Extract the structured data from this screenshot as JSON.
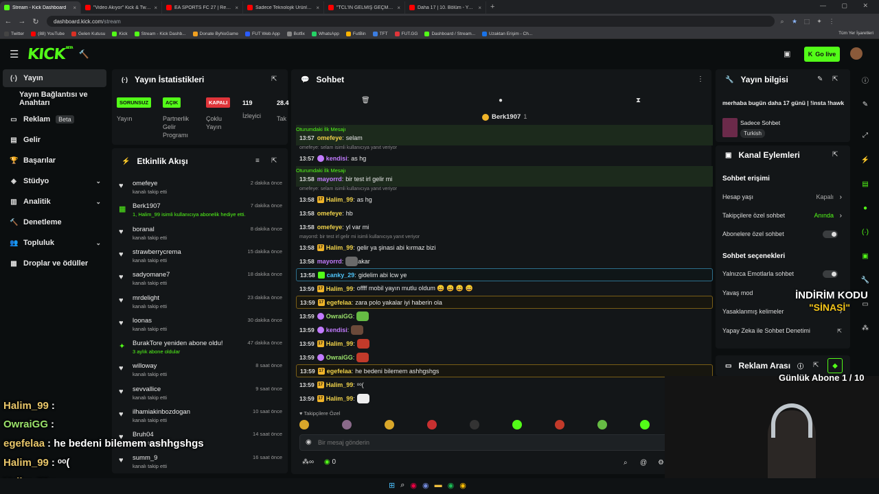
{
  "browser": {
    "tabs": [
      {
        "label": "Stream - Kick Dashboard",
        "color": "#53fc18",
        "active": true
      },
      {
        "label": "\"Video Akıyor\" Kick & Twitch İ",
        "color": "#ff0000"
      },
      {
        "label": "EA SPORTS FC 27 | Resmi Footb",
        "color": "#ff0000"
      },
      {
        "label": "Sadece Teknolojik Ürünleri Topl",
        "color": "#ff0000"
      },
      {
        "label": "\"TCL'İN GELMİŞ GEÇMİŞ EN İYİ",
        "color": "#ff0000"
      },
      {
        "label": "Daha 17 | 10. Bölüm - YouTube",
        "color": "#ff0000"
      }
    ],
    "new_tab": "+",
    "url_host": "dashboard.kick.com",
    "url_path": "/stream",
    "bookmarks": [
      {
        "label": "Twitter",
        "color": "#444"
      },
      {
        "label": "(88) YouTube",
        "color": "#ff0000"
      },
      {
        "label": "Gelen Kutusu",
        "color": "#d93025"
      },
      {
        "label": "Kick",
        "color": "#53fc18"
      },
      {
        "label": "Stream - Kick Dashb...",
        "color": "#53fc18"
      },
      {
        "label": "Donate ByNoGame",
        "color": "#f0a020"
      },
      {
        "label": "FUT Web App",
        "color": "#2a5cff"
      },
      {
        "label": "Botfix",
        "color": "#888"
      },
      {
        "label": "WhatsApp",
        "color": "#25d366"
      },
      {
        "label": "FutBin",
        "color": "#ffb400"
      },
      {
        "label": "TFT",
        "color": "#3c7de0"
      },
      {
        "label": "FUT.GG",
        "color": "#e0353a"
      },
      {
        "label": "Dashboard / Stream...",
        "color": "#53fc18"
      },
      {
        "label": "Uzaktan Erişim - Ch...",
        "color": "#1a73e8"
      }
    ],
    "all_bookmarks": "Tüm Yer İşaretleri"
  },
  "header": {
    "logo": "KICK",
    "logo_sup": "BETA",
    "go_live": "Go live"
  },
  "sidebar": {
    "items": [
      {
        "label": "Yayın",
        "icon": "broadcast-icon"
      },
      {
        "label": "Yayın Bağlantısı ve Anahtarı",
        "icon": ""
      },
      {
        "label": "Reklam",
        "icon": "ad-icon",
        "badge": "Beta"
      },
      {
        "label": "Gelir",
        "icon": "wallet-icon"
      },
      {
        "label": "Başarılar",
        "icon": "trophy-icon"
      },
      {
        "label": "Stüdyo",
        "icon": "layers-icon"
      },
      {
        "label": "Analitik",
        "icon": "chart-icon"
      },
      {
        "label": "Denetleme",
        "icon": "hammer-icon"
      },
      {
        "label": "Topluluk",
        "icon": "people-icon"
      },
      {
        "label": "Droplar ve ödüller",
        "icon": "gift-icon"
      }
    ]
  },
  "stats": {
    "title": "Yayın İstatistikleri",
    "items": [
      {
        "badge": "SORUNSUZ",
        "label": "Yayın",
        "badge_bg": "#53fc18",
        "badge_fg": "#111"
      },
      {
        "badge": "AÇIK",
        "label": "Partnerlik Gelir Programı",
        "badge_bg": "#53fc18",
        "badge_fg": "#111"
      },
      {
        "badge": "KAPALI",
        "label": "Çoklu Yayın",
        "badge_bg": "#e0353a",
        "badge_fg": "#fff"
      },
      {
        "badge": "119",
        "label": "İzleyici",
        "badge_bg": "",
        "badge_fg": "#fff"
      },
      {
        "badge": "28.4",
        "label": "Taki",
        "badge_bg": "",
        "badge_fg": "#fff"
      }
    ]
  },
  "activity": {
    "title": "Etkinlik Akışı",
    "events": [
      {
        "name": "omefeye",
        "sub": "kanalı takip etti",
        "time": "2 dakika önce",
        "icon": "heart-icon"
      },
      {
        "name": "Berk1907",
        "sub": "1, Halim_99 isimli kullanıcıya abonelik hediye etti.",
        "time": "7 dakika önce",
        "icon": "gift-icon",
        "green": true
      },
      {
        "name": "boranal",
        "sub": "kanalı takip etti",
        "time": "8 dakika önce",
        "icon": "heart-icon"
      },
      {
        "name": "strawberrycrema",
        "sub": "kanalı takip etti",
        "time": "15 dakika önce",
        "icon": "heart-icon"
      },
      {
        "name": "sadyomane7",
        "sub": "kanalı takip etti",
        "time": "18 dakika önce",
        "icon": "heart-icon"
      },
      {
        "name": "mrdelight",
        "sub": "kanalı takip etti",
        "time": "23 dakika önce",
        "icon": "heart-icon"
      },
      {
        "name": "loonas",
        "sub": "kanalı takip etti",
        "time": "30 dakika önce",
        "icon": "heart-icon"
      },
      {
        "name": "BurakTore yeniden abone oldu!",
        "sub": "3 aylık abone oldular",
        "time": "47 dakika önce",
        "icon": "star-icon",
        "green": true
      },
      {
        "name": "willoway",
        "sub": "kanalı takip etti",
        "time": "8 saat önce",
        "icon": "heart-icon"
      },
      {
        "name": "sevvallice",
        "sub": "kanalı takip etti",
        "time": "9 saat önce",
        "icon": "heart-icon"
      },
      {
        "name": "ilhamiakinbozdogan",
        "sub": "kanalı takip etti",
        "time": "10 saat önce",
        "icon": "heart-icon"
      },
      {
        "name": "Bruh04",
        "sub": "kanalı takip etti",
        "time": "14 saat önce",
        "icon": "heart-icon"
      },
      {
        "name": "summ_9",
        "sub": "kanalı takip etti",
        "time": "16 saat önce",
        "icon": "heart-icon"
      }
    ]
  },
  "chat": {
    "title": "Sohbet",
    "pinned_user": "Berk1907",
    "pinned_count": "1",
    "first_msg_label": "Oturumdaki İlk Mesajı",
    "messages": [
      {
        "time": "13:57",
        "user": "omefeye",
        "color": "#f0d24a",
        "text": "selam"
      },
      {
        "time": "13:57",
        "user": "kendisi",
        "color": "#c27bff",
        "text": "as hg",
        "reply": "omefeye: selam isimli kullanıcıya yanıt veriyor"
      },
      {
        "time": "13:58",
        "user": "mayorrd",
        "color": "#c27bff",
        "text": "bir test irl gelir mi"
      },
      {
        "time": "13:58",
        "user": "Halim_99",
        "color": "#f0d24a",
        "text": "as hg",
        "reply": "omefeye: selam isimli kullanıcıya yanıt veriyor"
      },
      {
        "time": "13:58",
        "user": "omefeye",
        "color": "#f0d24a",
        "text": "hb"
      },
      {
        "time": "13:58",
        "user": "omefeye",
        "color": "#f0d24a",
        "text": "yl var mi"
      },
      {
        "time": "13:58",
        "user": "Halim_99",
        "color": "#f0d24a",
        "text": "gelir ya şinasi abi kırmaz bizi",
        "reply": "mayorrd: bir test irl gelir mi isimli kullanıcıya yanıt veriyor"
      },
      {
        "time": "13:58",
        "user": "mayorrd",
        "color": "#c27bff",
        "text": "akar"
      },
      {
        "time": "13:58",
        "user": "canky_29",
        "color": "#4fc3f7",
        "text": "gidelim abi lcw ye"
      },
      {
        "time": "13:59",
        "user": "Halim_99",
        "color": "#f0d24a",
        "text": "offff mobil yayın mutlu oldum 😄 😄 😄 😄"
      },
      {
        "time": "13:59",
        "user": "egefelaa",
        "color": "#f0d24a",
        "text": "zara polo yakalar iyi haberin ola"
      },
      {
        "time": "13:59",
        "user": "OwraiGG",
        "color": "#9be26b",
        "text": ""
      },
      {
        "time": "13:59",
        "user": "kendisi",
        "color": "#c27bff",
        "text": ""
      },
      {
        "time": "13:59",
        "user": "Halim_99",
        "color": "#f0d24a",
        "text": ""
      },
      {
        "time": "13:59",
        "user": "OwraiGG",
        "color": "#9be26b",
        "text": ""
      },
      {
        "time": "13:59",
        "user": "egefelaa",
        "color": "#f0d24a",
        "text": "he bedeni bilemem ashhgshgs"
      },
      {
        "time": "13:59",
        "user": "Halim_99",
        "color": "#f0d24a",
        "text": "ᵒᵒ("
      },
      {
        "time": "13:59",
        "user": "Halim_99",
        "color": "#f0d24a",
        "text": ""
      }
    ],
    "followers_label": "Takipçilere Özel",
    "placeholder": "Bir mesaj gönderin",
    "points": "0"
  },
  "info": {
    "title": "Yayın bilgisi",
    "stream_title": "merhaba bugün daha 17 günü | !insta !hawk",
    "category": "Sadece Sohbet",
    "language": "Turkish"
  },
  "actions": {
    "title": "Kanal Eylemleri",
    "access_title": "Sohbet erişimi",
    "account_age": "Hesap yaşı",
    "account_age_val": "Kapalı",
    "followers_only": "Takipçilere özel sohbet",
    "followers_only_val": "Anında",
    "subs_only": "Abonelere özel sohbet",
    "options_title": "Sohbet seçenekleri",
    "emotes_only": "Yalnızca Emotlarla sohbet",
    "slow_mode": "Yavaş mod",
    "banned_words": "Yasaklanmış kelimeler",
    "ai_mod": "Yapay Zeka ile Sohbet Denetimi"
  },
  "ad_break": {
    "title": "Reklam Arası"
  },
  "overlay": {
    "promo_line1": "İNDİRİM KODU",
    "promo_line2": "\"SİNASİ\"",
    "sub_goal": "Günlük Abone 1 / 10",
    "chat": [
      {
        "user": "Halim_99",
        "text": ":"
      },
      {
        "user": "OwraiGG",
        "text": ":"
      },
      {
        "user": "egefelaa",
        "text": ": he bedeni bilemem ashhgshgs"
      },
      {
        "user": "Halim_99",
        "text": ": ᵒᵒ("
      },
      {
        "user": "Halim_99",
        "text": ":"
      }
    ]
  }
}
